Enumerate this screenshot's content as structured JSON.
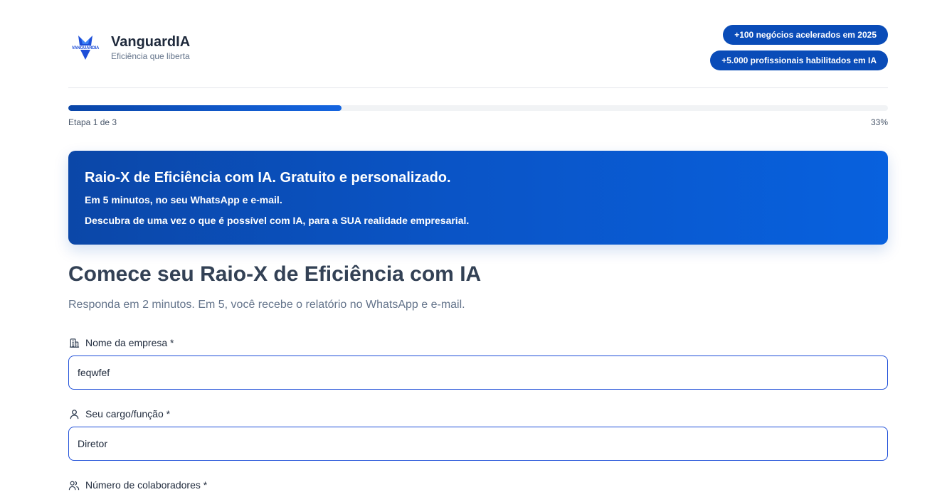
{
  "brand": {
    "logo_text": "VANGUARDIA",
    "name": "VanguardIA",
    "tagline": "Eficiência que liberta"
  },
  "badges": [
    "+100 negócios acelerados em 2025",
    "+5.000 profissionais habilitados em IA"
  ],
  "progress": {
    "step_label": "Etapa 1 de 3",
    "percent_label": "33%",
    "fraction": 0.333
  },
  "hero": {
    "title": "Raio-X de Eficiência com IA. Gratuito e personalizado.",
    "line1": "Em 5 minutos, no seu WhatsApp e e-mail.",
    "line2": "Descubra de uma vez o que é possível com IA, para a SUA realidade empresarial."
  },
  "form": {
    "title": "Comece seu Raio-X de Eficiência com IA",
    "subtitle": "Responda em 2 minutos. Em 5, você recebe o relatório no WhatsApp e e-mail.",
    "fields": [
      {
        "label": "Nome da empresa *",
        "icon": "building-icon",
        "value": "feqwfef"
      },
      {
        "label": "Seu cargo/função *",
        "icon": "user-icon",
        "value": "Diretor"
      },
      {
        "label": "Número de colaboradores *",
        "icon": "users-icon",
        "value": ""
      }
    ]
  },
  "colors": {
    "accent": "#0a4cb8",
    "input_border": "#1d4ed8",
    "title": "#334155",
    "muted": "#64748b"
  }
}
